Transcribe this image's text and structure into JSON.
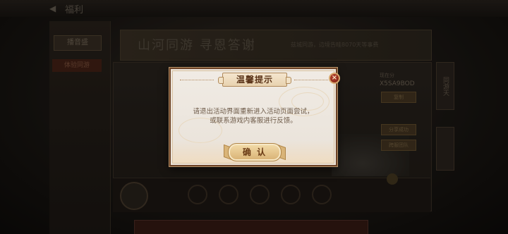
{
  "background": {
    "title": "福利",
    "banner_title": "山河同游 寻恩答谢",
    "banner_subtitle": "兹城同游，边境告畦8070天等事费",
    "left_tab_primary": "播音盛",
    "left_tab_secondary": "体验同游",
    "right_tag": "现在分",
    "right_code": "X5SA9BOD",
    "right_buttons": [
      "复制",
      "分享成功",
      "跨服团队"
    ],
    "side_tab": "同游天"
  },
  "dialog": {
    "title": "温馨提示",
    "message_line1": "请退出活动界面重新进入活动页面尝试，",
    "message_line2": "或联系游戏内客服进行反馈。",
    "confirm_label": "确 认",
    "close_glyph": "×"
  },
  "colors": {
    "dialog_border": "#6e4427",
    "dialog_bg": "#ece4da",
    "title_text": "#5b3419",
    "close_red": "#9b2c1c",
    "button_gold": "#d8b173"
  }
}
